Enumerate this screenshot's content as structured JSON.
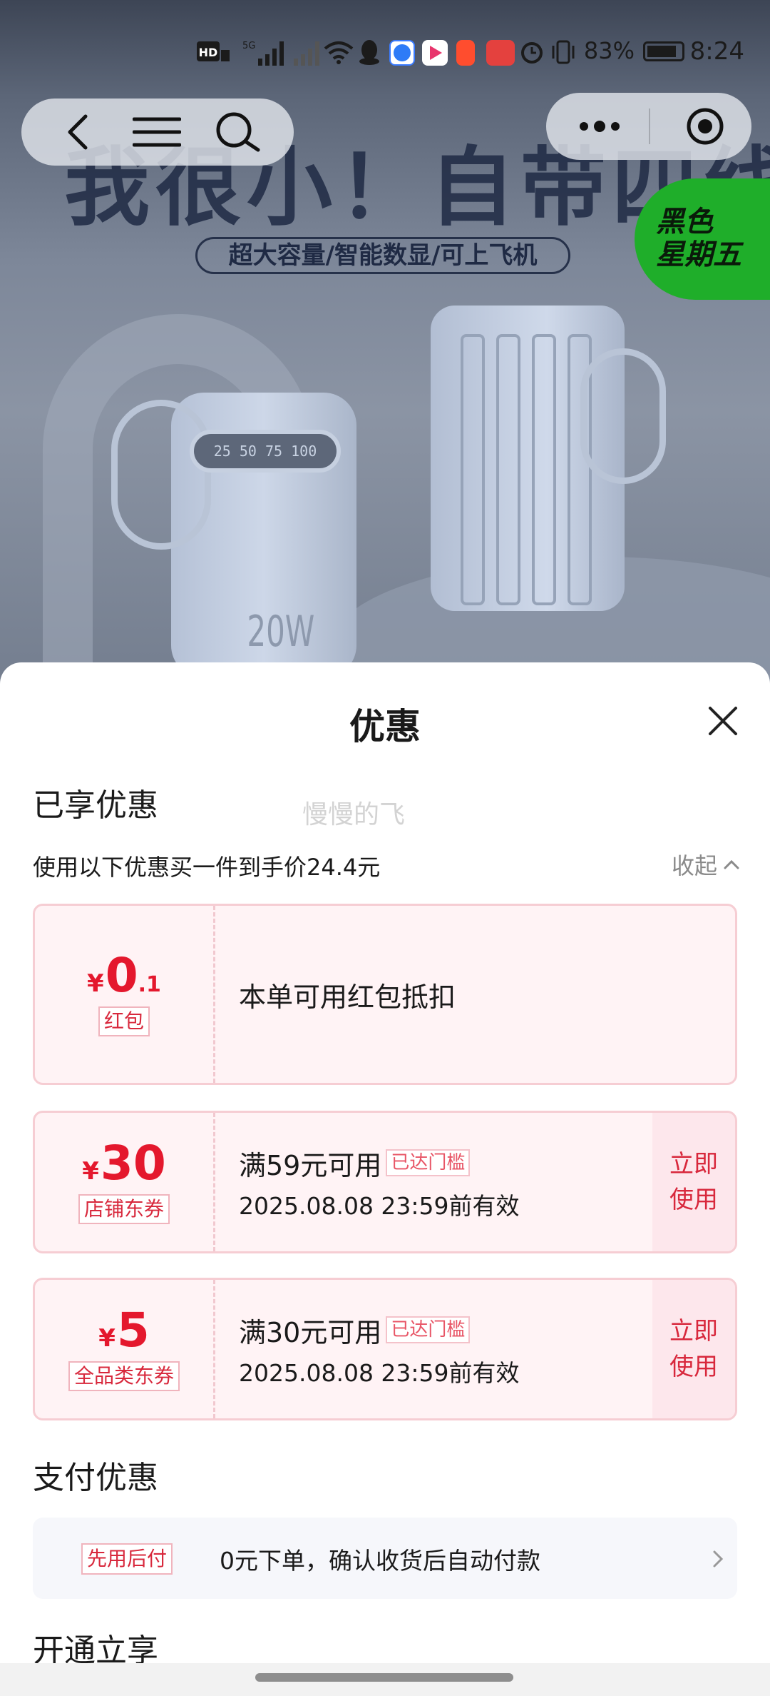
{
  "status_bar": {
    "network_label": "HD",
    "signal_label": "5G",
    "battery_percent": "83%",
    "time": "8:24",
    "icons": [
      "hd-icon",
      "signal-icon",
      "wifi-icon",
      "qq-icon",
      "browser-app-icon",
      "video-app-icon",
      "app-icon",
      "huawei-app-icon",
      "alarm-icon",
      "vibrate-icon",
      "battery-icon"
    ]
  },
  "hero": {
    "title": "我很小！自带四线",
    "subtitle": "超大容量/智能数显/可上飞机",
    "badge_line1": "黑色",
    "badge_line2": "星期五",
    "lcd_text": "25 50 75 100",
    "wattage_text": "20W"
  },
  "nav": {
    "icons": [
      "back-icon",
      "menu-icon",
      "search-icon",
      "more-icon",
      "target-icon"
    ]
  },
  "sheet": {
    "title": "优惠",
    "section_enjoyed": "已享优惠",
    "watermark": "慢慢的飞",
    "summary": "使用以下优惠买一件到手价24.4元",
    "collapse_label": "收起",
    "coupons": [
      {
        "currency": "¥",
        "amount_int": "0",
        "amount_dec": ".1",
        "tag": "红包",
        "desc": "本单可用红包抵扣"
      },
      {
        "currency": "¥",
        "amount_int": "30",
        "tag": "店铺东券",
        "condition": "满59元可用",
        "status": "已达门槛",
        "validity": "2025.08.08 23:59前有效",
        "action": "立即使用"
      },
      {
        "currency": "¥",
        "amount_int": "5",
        "tag": "全品类东券",
        "condition": "满30元可用",
        "status": "已达门槛",
        "validity": "2025.08.08 23:59前有效",
        "action": "立即使用"
      }
    ],
    "section_payment": "支付优惠",
    "payment": {
      "tag": "先用后付",
      "text": "0元下单，确认收货后自动付款"
    },
    "section_open": "开通立享"
  },
  "colors": {
    "accent_red": "#e4182d",
    "coupon_bg": "#fff3f5",
    "coupon_border": "#f6cdd3",
    "badge_green": "#1fae2a"
  }
}
